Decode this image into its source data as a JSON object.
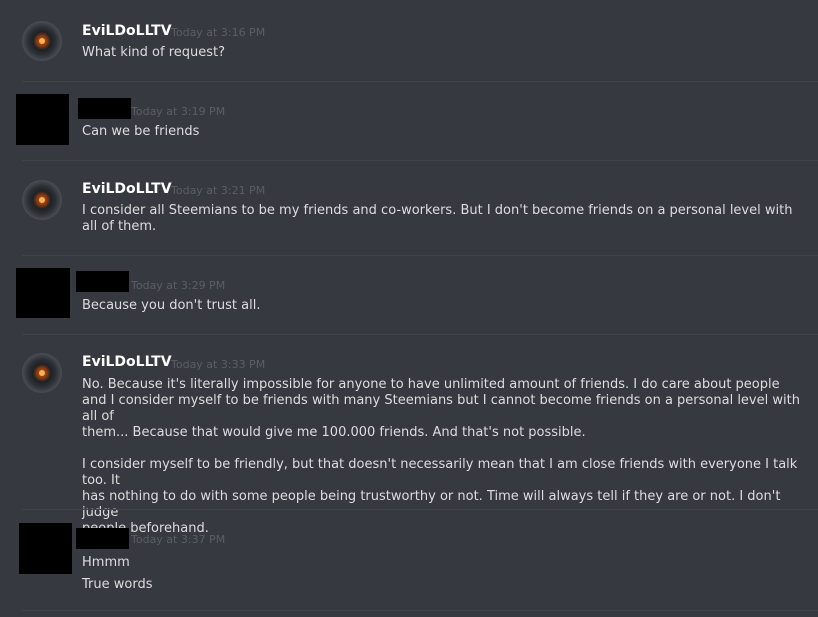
{
  "messages": [
    {
      "author": "EviLDoLLTV",
      "time": "Today at 3:16 PM",
      "lines": [
        "What kind of request?"
      ]
    },
    {
      "author": "",
      "time": "Today at 3:19 PM",
      "lines": [
        "Can we be friends"
      ]
    },
    {
      "author": "EviLDoLLTV",
      "time": "Today at 3:21 PM",
      "lines": [
        "I consider all Steemians to be my friends and co-workers. But I don't become friends on a personal level with",
        "all of them."
      ]
    },
    {
      "author": "",
      "time": "Today at 3:29 PM",
      "lines": [
        "Because you don't trust all."
      ]
    },
    {
      "author": "EviLDoLLTV",
      "time": "Today at 3:33 PM",
      "para1": [
        "No. Because it's literally impossible for anyone to have unlimited amount of friends. I do care about people",
        "and I consider myself to be friends with many Steemians but I cannot become friends on a personal level with all of",
        "them... Because that would give me 100.000 friends. And that's not possible."
      ],
      "para2": [
        "I consider myself to be friendly, but that doesn't necessarily mean that I am close friends with everyone I talk too. It",
        "has nothing to do with some people being trustworthy or not. Time will always tell if they are or not. I don't judge",
        "people beforehand."
      ]
    },
    {
      "author": "",
      "time": "Today at 3:37 PM",
      "lines": [
        "Hmmm",
        "True words"
      ]
    }
  ]
}
